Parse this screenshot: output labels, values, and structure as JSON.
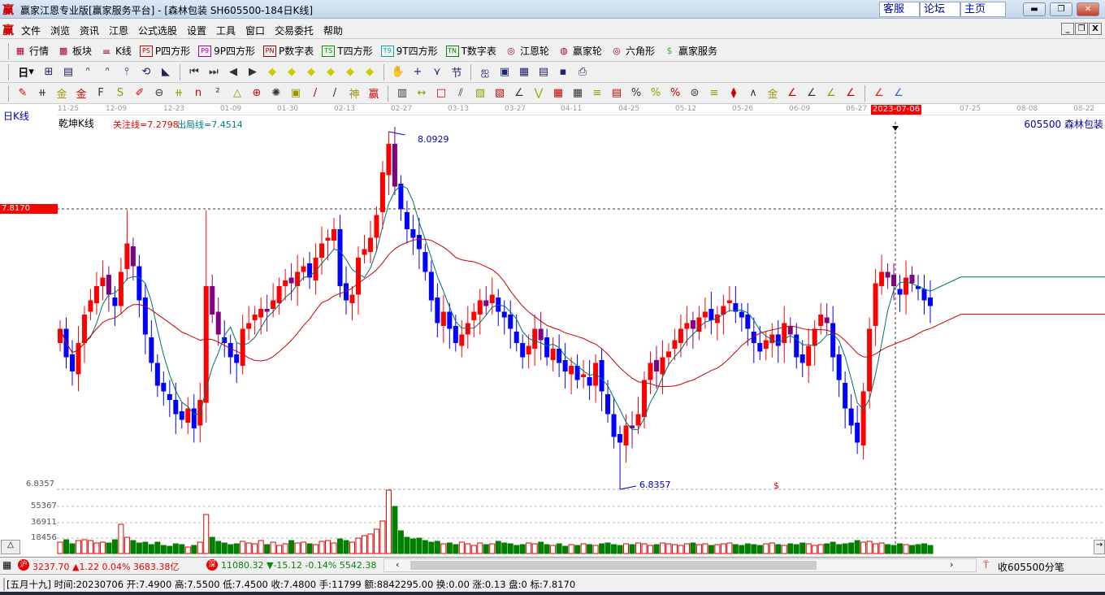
{
  "window": {
    "title": "赢家江恩专业版[赢家服务平台] - [森林包装  SH605500-184日K线]",
    "logo": "赢",
    "links": [
      "客服",
      "论坛",
      "主页"
    ]
  },
  "menu": {
    "logo": "赢",
    "items": [
      "文件",
      "浏览",
      "资讯",
      "江恩",
      "公式选股",
      "设置",
      "工具",
      "窗口",
      "交易委托",
      "帮助"
    ]
  },
  "toolbar1": [
    {
      "icon": "quote-table-icon",
      "glyph": "▦",
      "label": "行情"
    },
    {
      "icon": "sector-icon",
      "glyph": "▩",
      "label": "板块"
    },
    {
      "icon": "kline-icon",
      "glyph": "𝍢",
      "label": "K线"
    },
    {
      "icon": "ps-icon",
      "glyph": "PS",
      "label": "P四方形"
    },
    {
      "icon": "p9-icon",
      "glyph": "P9",
      "label": "9P四方形"
    },
    {
      "icon": "pn-icon",
      "glyph": "PN",
      "label": "P数字表"
    },
    {
      "icon": "ts-icon",
      "glyph": "TS",
      "label": "T四方形"
    },
    {
      "icon": "t9-icon",
      "glyph": "T9",
      "label": "9T四方形"
    },
    {
      "icon": "tn-icon",
      "glyph": "TN",
      "label": "T数字表"
    },
    {
      "icon": "gann-wheel-icon",
      "glyph": "◎",
      "label": "江恩轮"
    },
    {
      "icon": "winner-wheel-icon",
      "glyph": "◍",
      "label": "赢家轮"
    },
    {
      "icon": "hexagon-icon",
      "glyph": "◎",
      "label": "六角形"
    },
    {
      "icon": "dollar-icon",
      "glyph": "$",
      "label": "赢家服务"
    }
  ],
  "toolbar2": {
    "period": "日",
    "icons": [
      "chart-type-icon",
      "list-icon",
      "ma3-icon",
      "ma9-icon",
      "candle-type-icon",
      "restore-icon",
      "volume-profile-icon",
      "first-icon",
      "last-icon",
      "prev-icon",
      "next-icon",
      "left-icon",
      "right-icon",
      "expand-h-icon",
      "shrink-h-icon",
      "expand-v-icon",
      "shrink-v-icon",
      "hand-icon",
      "crosshair-icon",
      "line-tool-icon",
      "section-icon",
      "calc-icon",
      "calendar-icon",
      "calculator-icon",
      "notes-icon",
      "save-icon",
      "print-icon"
    ]
  },
  "toolbar3": {
    "icons": [
      "pen-icon",
      "lines-icon",
      "gold-line-icon",
      "gold-line2-icon",
      "fib-icon",
      "spiral-icon",
      "eraser-icon",
      "circle-icon",
      "parallel-icon",
      "n2-icon",
      "triangle-icon",
      "target-icon",
      "web-icon",
      "square-icon",
      "fan-lines-icon",
      "shen-icon",
      "ying-icon",
      "grid-icon",
      "range-icon",
      "box-icon",
      "fan-icon",
      "cube-icon",
      "diamond-icon",
      "angle-icon",
      "zigzag-icon",
      "grid2-icon",
      "grid3-icon",
      "slant-icon",
      "bars-icon",
      "pct2-icon",
      "percent-icon",
      "pct-lines-icon",
      "gold-coin-icon",
      "gold-lines-icon",
      "pen2-icon",
      "wave-icon",
      "gold-box-icon",
      "j-angle-icon",
      "f-angle-icon",
      "gold-angle-icon",
      "shen-angle-icon",
      "ying-angle-icon",
      "four-angle-icon",
      "taiji-icon",
      "infinity-icon"
    ]
  },
  "chart": {
    "period_label": "日K线",
    "indicator_name": "乾坤K线",
    "focus_line": "关注线=7.2798",
    "exit_line": "出局线=7.4514",
    "stock_label": "605500  森林包装",
    "crosshair_price": "7.8170",
    "crosshair_date": "2023-07-06",
    "high_label": "8.0929",
    "low_label": "6.8357",
    "price_axis_low": "6.8357",
    "dollar_mark": "$",
    "volume_ticks": [
      "55367",
      "36911",
      "18456"
    ],
    "dates": [
      "11-25",
      "12-09",
      "12-23",
      "01-09",
      "01-30",
      "02-13",
      "02-27",
      "03-13",
      "03-27",
      "04-11",
      "04-25",
      "05-12",
      "05-26",
      "06-09",
      "06-27",
      "07-25",
      "08-08",
      "08-22"
    ]
  },
  "chart_data": {
    "type": "candlestick",
    "high": 8.0929,
    "low": 6.8357,
    "closes": [
      7.4,
      7.3,
      7.25,
      7.35,
      7.45,
      7.5,
      7.55,
      7.58,
      7.52,
      7.48,
      7.6,
      7.7,
      7.62,
      7.5,
      7.38,
      7.28,
      7.2,
      7.18,
      7.15,
      7.1,
      7.08,
      7.12,
      7.05,
      7.15,
      7.55,
      7.45,
      7.38,
      7.35,
      7.3,
      7.28,
      7.4,
      7.42,
      7.45,
      7.47,
      7.46,
      7.5,
      7.55,
      7.57,
      7.56,
      7.6,
      7.62,
      7.58,
      7.65,
      7.7,
      7.72,
      7.75,
      7.55,
      7.5,
      7.52,
      7.65,
      7.68,
      7.72,
      7.8,
      7.95,
      8.05,
      7.9,
      7.82,
      7.75,
      7.72,
      7.68,
      7.6,
      7.5,
      7.42,
      7.46,
      7.4,
      7.35,
      7.38,
      7.42,
      7.46,
      7.5,
      7.48,
      7.52,
      7.46,
      7.44,
      7.4,
      7.35,
      7.3,
      7.34,
      7.4,
      7.36,
      7.3,
      7.33,
      7.28,
      7.25,
      7.27,
      7.22,
      7.24,
      7.2,
      7.28,
      7.18,
      7.1,
      7.02,
      7.0,
      7.06,
      7.05,
      7.1,
      7.22,
      7.28,
      7.25,
      7.3,
      7.32,
      7.36,
      7.4,
      7.42,
      7.4,
      7.44,
      7.46,
      7.43,
      7.45,
      7.48,
      7.5,
      7.46,
      7.44,
      7.4,
      7.35,
      7.32,
      7.36,
      7.38,
      7.34,
      7.42,
      7.38,
      7.3,
      7.28,
      7.34,
      7.4,
      7.45,
      7.42,
      7.3,
      7.22,
      7.12,
      7.06,
      7.0,
      7.18,
      7.4,
      7.56,
      7.6,
      7.58,
      7.55,
      7.52,
      7.58,
      7.56,
      7.54,
      7.5,
      7.48
    ],
    "volumes": [
      14,
      17,
      12,
      16,
      17,
      16,
      13,
      14,
      13,
      17,
      36,
      20,
      16,
      13,
      14,
      11,
      14,
      10,
      9,
      12,
      11,
      8,
      10,
      14,
      48,
      20,
      15,
      13,
      11,
      12,
      15,
      13,
      12,
      16,
      11,
      14,
      10,
      12,
      16,
      13,
      14,
      12,
      11,
      15,
      16,
      13,
      18,
      16,
      14,
      19,
      22,
      24,
      30,
      40,
      78,
      58,
      28,
      20,
      18,
      19,
      16,
      14,
      15,
      12,
      13,
      11,
      14,
      12,
      10,
      13,
      11,
      12,
      15,
      13,
      12,
      10,
      11,
      13,
      12,
      14,
      11,
      10,
      12,
      9,
      11,
      10,
      12,
      11,
      10,
      12,
      13,
      11,
      10,
      12,
      11,
      13,
      12,
      10,
      11,
      13,
      12,
      11,
      10,
      12,
      13,
      11,
      12,
      10,
      11,
      12,
      13,
      11,
      10,
      12,
      11,
      10,
      12,
      13,
      11,
      10,
      12,
      11,
      13,
      12,
      10,
      11,
      12,
      14,
      11,
      12,
      13,
      16,
      14,
      15,
      12,
      13,
      11,
      10,
      12,
      11,
      10,
      11,
      12,
      10
    ]
  },
  "status": {
    "sh_badge": "沪",
    "sh_index": "3237.70",
    "sh_change": "▲1.22",
    "sh_pct": "0.04%",
    "sh_amount": "3683.38亿",
    "sz_badge": "深",
    "sz_index": "11080.32",
    "sz_change": "▼-15.12",
    "sz_pct": "-0.14%",
    "sz_amount": "5542.38",
    "tick_label": "收605500分笔"
  },
  "info": "[五月十九] 时间:20230706 开:7.4900 高:7.5500 低:7.4500 收:7.4800 手:11799 额:8842295.00 换:0.00 涨:0.13 盘:0 标:7.8170",
  "colors": {
    "up": "#ff0000",
    "down": "#0000ff",
    "down_alt": "#800080",
    "vol_down": "#008000",
    "ma_short": "#007070",
    "ma_long": "#cc0000"
  }
}
